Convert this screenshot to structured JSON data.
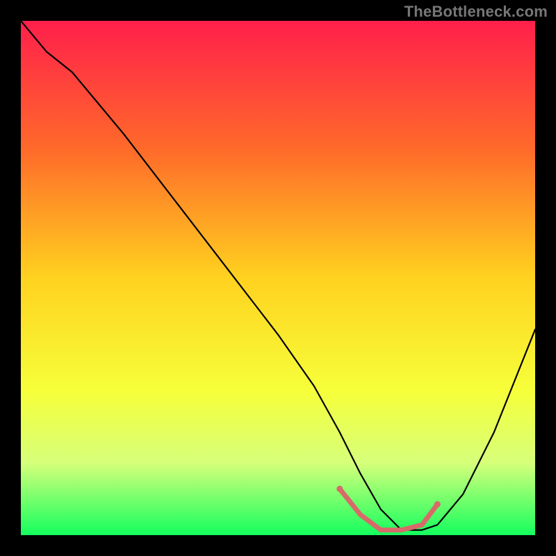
{
  "watermark": "TheBottleneck.com",
  "chart_data": {
    "type": "line",
    "title": "",
    "xlabel": "",
    "ylabel": "",
    "xlim": [
      0,
      100
    ],
    "ylim": [
      0,
      100
    ],
    "gradient_stops": [
      {
        "offset": 0,
        "color": "#ff1f4b"
      },
      {
        "offset": 25,
        "color": "#ff6a2a"
      },
      {
        "offset": 50,
        "color": "#ffd21f"
      },
      {
        "offset": 72,
        "color": "#f6ff3a"
      },
      {
        "offset": 86,
        "color": "#d6ff7a"
      },
      {
        "offset": 100,
        "color": "#14ff5e"
      }
    ],
    "series": [
      {
        "name": "bottleneck-curve",
        "stroke": "#000000",
        "stroke_width": 2.2,
        "x": [
          0,
          5,
          10,
          20,
          30,
          40,
          50,
          57,
          62,
          66,
          70,
          74,
          78,
          81,
          86,
          92,
          100
        ],
        "y": [
          100,
          94,
          90,
          78,
          65,
          52,
          39,
          29,
          20,
          12,
          5,
          1,
          1,
          2,
          8,
          20,
          40
        ]
      },
      {
        "name": "optimal-band",
        "stroke": "#d86a6a",
        "stroke_width": 7,
        "x": [
          62,
          66,
          70,
          74,
          78,
          81
        ],
        "y": [
          9,
          4,
          1,
          1,
          2,
          6
        ]
      }
    ],
    "markers": [
      {
        "name": "optimal-start",
        "x": 62,
        "y": 9,
        "r": 4.5,
        "fill": "#d86a6a"
      },
      {
        "name": "optimal-end",
        "x": 81,
        "y": 6,
        "r": 4.5,
        "fill": "#d86a6a"
      }
    ]
  }
}
